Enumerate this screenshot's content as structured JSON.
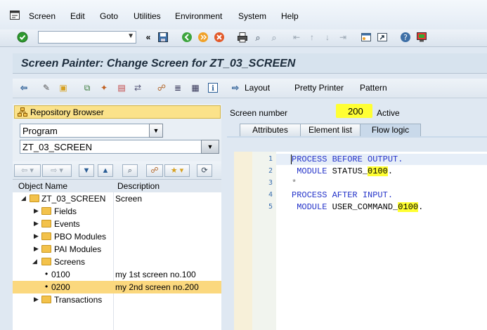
{
  "menu": [
    "Screen",
    "Edit",
    "Goto",
    "Utilities",
    "Environment",
    "System",
    "Help"
  ],
  "title": "Screen Painter: Change Screen for ZT_03_SCREEN",
  "appbar": {
    "layout": "Layout",
    "pretty_printer": "Pretty Printer",
    "pattern": "Pattern"
  },
  "left": {
    "repository_browser": "Repository Browser",
    "object_type": "Program",
    "object_name": "ZT_03_SCREEN",
    "columns": {
      "name": "Object Name",
      "description": "Description"
    },
    "tree": [
      {
        "name": "ZT_03_SCREEN",
        "description": "Screen",
        "level": 0,
        "type": "folder",
        "expanded": true
      },
      {
        "name": "Fields",
        "description": "",
        "level": 1,
        "type": "folder",
        "expanded": false
      },
      {
        "name": "Events",
        "description": "",
        "level": 1,
        "type": "folder",
        "expanded": false
      },
      {
        "name": "PBO Modules",
        "description": "",
        "level": 1,
        "type": "folder",
        "expanded": false
      },
      {
        "name": "PAI Modules",
        "description": "",
        "level": 1,
        "type": "folder",
        "expanded": false
      },
      {
        "name": "Screens",
        "description": "",
        "level": 1,
        "type": "folder",
        "expanded": true
      },
      {
        "name": "0100",
        "description": "my 1st screen no.100",
        "level": 2,
        "type": "item"
      },
      {
        "name": "0200",
        "description": "my 2nd screen no.200",
        "level": 2,
        "type": "item",
        "selected": true
      },
      {
        "name": "Transactions",
        "description": "",
        "level": 1,
        "type": "folder",
        "expanded": false
      }
    ]
  },
  "right": {
    "screen_number_label": "Screen number",
    "screen_number": "200",
    "status": "Active",
    "tabs": [
      {
        "label": "Attributes",
        "active": false
      },
      {
        "label": "Element list",
        "active": false
      },
      {
        "label": "Flow logic",
        "active": true
      }
    ],
    "code": [
      {
        "num": "1",
        "text": "PROCESS BEFORE OUTPUT."
      },
      {
        "num": "2",
        "text": " MODULE STATUS_0100."
      },
      {
        "num": "3",
        "text": "*"
      },
      {
        "num": "4",
        "text": "PROCESS AFTER INPUT."
      },
      {
        "num": "5",
        "text": " MODULE USER_COMMAND_0100."
      }
    ]
  }
}
